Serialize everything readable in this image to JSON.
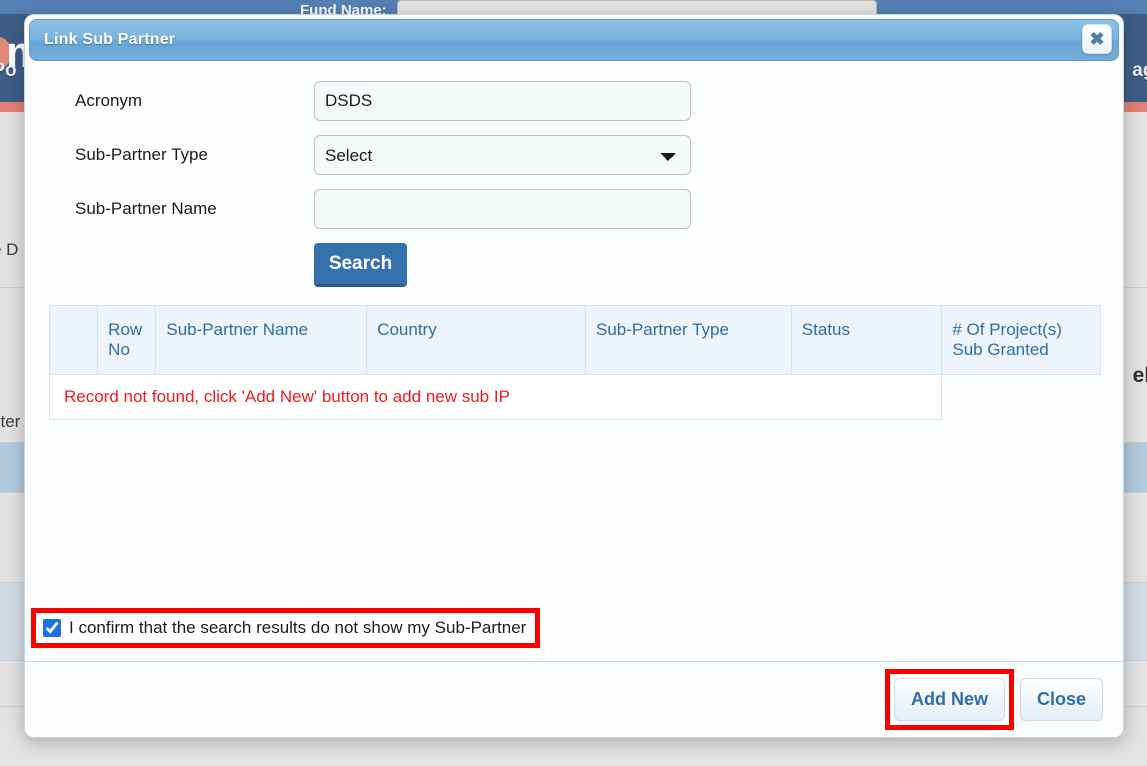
{
  "background": {
    "brand_mark": "m",
    "fund_name_label": "Fund Name:",
    "fund_name_value": "",
    "nav_left_text": "-Po",
    "nav_right_text": "age",
    "content_left_1": "e D",
    "content_left_2": "ster",
    "content_right": "elo"
  },
  "modal": {
    "title": "Link Sub Partner",
    "close_icon": "close-icon",
    "close_glyph": "✖",
    "form": {
      "acronym_label": "Acronym",
      "acronym_value": "DSDS",
      "acronym_placeholder": "",
      "subpartner_type_label": "Sub-Partner Type",
      "subpartner_type_selected": "Select",
      "subpartner_type_options": [
        "Select"
      ],
      "subpartner_name_label": "Sub-Partner Name",
      "subpartner_name_value": "",
      "subpartner_name_placeholder": "",
      "search_button_label": "Search"
    },
    "table": {
      "headers": [
        "",
        "Row No",
        "Sub-Partner Name",
        "Country",
        "Sub-Partner Type",
        "Status",
        "# Of Project(s) Sub Granted"
      ],
      "empty_message": "Record not found, click 'Add New' button to add new sub IP",
      "rows": []
    },
    "confirm": {
      "label": "I confirm that the search results do not show my Sub-Partner",
      "checked": true
    },
    "footer": {
      "add_new_label": "Add New",
      "close_label": "Close"
    }
  },
  "colors": {
    "titlebar_start": "#8dc0e4",
    "titlebar_end": "#76addb",
    "search_button": "#3471ad",
    "error_text": "#ee1c1c",
    "highlight_outline": "#fc0000",
    "table_header_bg": "#edf4fb",
    "table_header_text": "#2f6f9f",
    "nav_bg": "#3e5d85",
    "nav_accent": "#df8279"
  }
}
